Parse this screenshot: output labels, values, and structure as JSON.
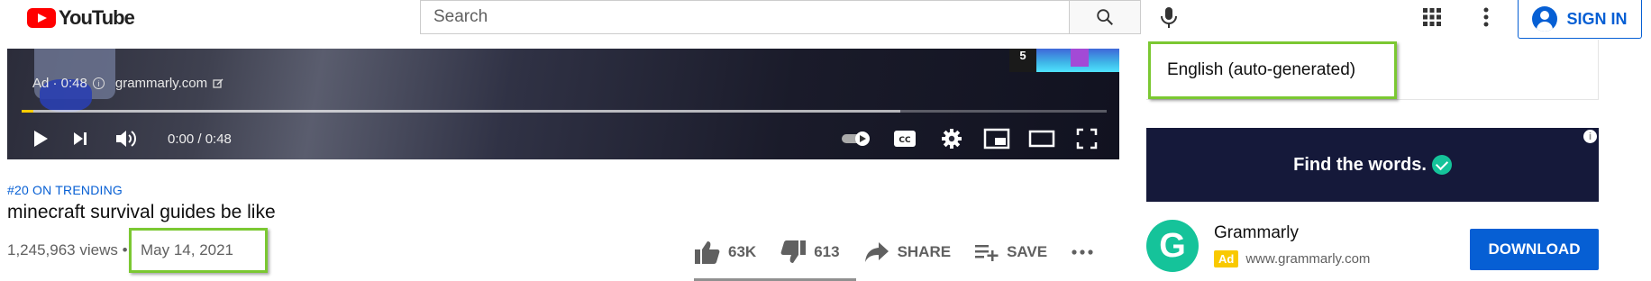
{
  "header": {
    "logo_text": "YouTube",
    "search_placeholder": "Search",
    "signin_label": "SIGN IN"
  },
  "player": {
    "ad_label": "Ad · 0:48",
    "ad_domain": "grammarly.com",
    "up_next_number": "5",
    "time_display": "0:00 / 0:48",
    "progress_loaded": 0.81,
    "progress_played": 0.011,
    "accent_color": "#ffcc00"
  },
  "video": {
    "trending": "#20 ON TRENDING",
    "title": "minecraft survival guides be like",
    "views": "1,245,963 views",
    "separator": "•",
    "date": "May 14, 2021",
    "actions": {
      "likes": "63K",
      "dislikes": "613",
      "share": "SHARE",
      "save": "SAVE"
    }
  },
  "sidebar": {
    "transcript_language": "English (auto-generated)",
    "banner_text": "Find the words.",
    "advertiser": {
      "name": "Grammarly",
      "badge": "Ad",
      "url": "www.grammarly.com",
      "logo_letter": "G",
      "cta": "DOWNLOAD"
    }
  },
  "colors": {
    "brand_red": "#ff0000",
    "link_blue": "#065fd4",
    "highlight_green": "#7bc832",
    "grammarly_green": "#15c39a"
  }
}
